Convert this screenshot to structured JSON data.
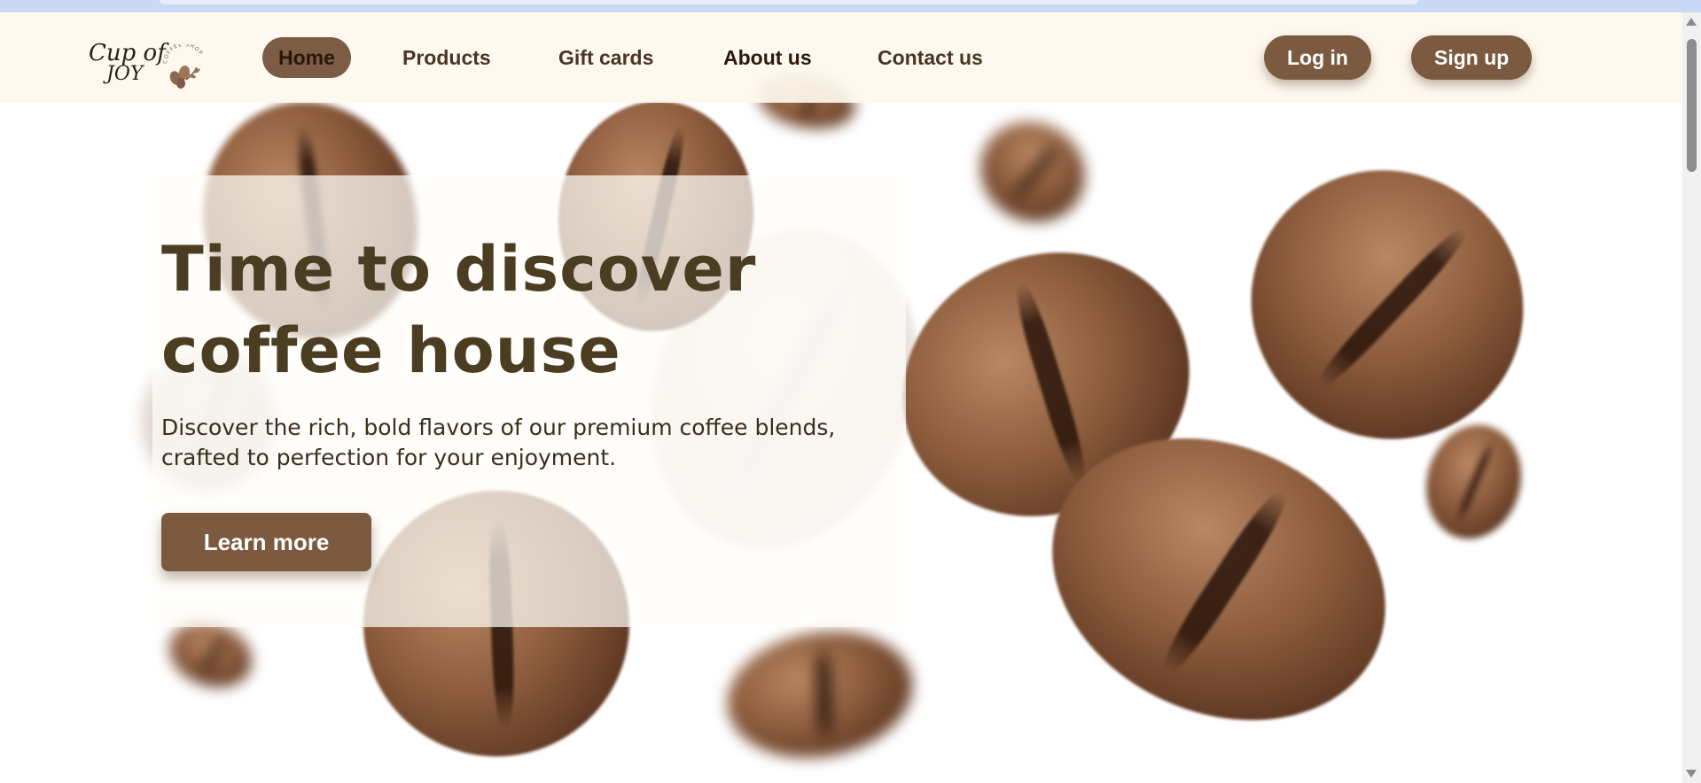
{
  "navbar": {
    "logo": {
      "line1": "Cup of",
      "line2": "JOY",
      "badge_text": "COFFEE SHOP",
      "icon": "coffee-branch-logo-icon"
    },
    "links": [
      {
        "label": "Home",
        "active": true
      },
      {
        "label": "Products",
        "active": false
      },
      {
        "label": "Gift cards",
        "active": false
      },
      {
        "label": "About us",
        "active": false
      },
      {
        "label": "Contact us",
        "active": false
      }
    ],
    "login_label": "Log in",
    "signup_label": "Sign up"
  },
  "hero": {
    "title": "Time to discover coffee house",
    "subtitle": "Discover the rich, bold flavors of our premium coffee blends, crafted to perfection for your enjoyment.",
    "cta_label": "Learn more",
    "background": "coffee-beans-image"
  },
  "colors": {
    "accent": "#7c5a3f",
    "nav_background": "#fef8ee",
    "title_color": "#4a3d22",
    "text_color": "#3c2e1c"
  }
}
